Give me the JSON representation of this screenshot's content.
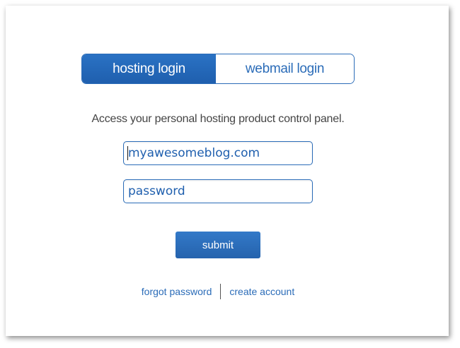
{
  "tabs": {
    "hosting_label": "hosting login",
    "webmail_label": "webmail login"
  },
  "description": "Access your personal hosting product control panel.",
  "form": {
    "username_value": "myawesomeblog.com",
    "password_placeholder": "password",
    "submit_label": "submit"
  },
  "links": {
    "forgot_password": "forgot password",
    "create_account": "create account"
  },
  "colors": {
    "accent": "#2b6cb8",
    "tab_active_bg": "#1f5fae",
    "button_bg": "#2b6cb8",
    "text": "#444444"
  }
}
